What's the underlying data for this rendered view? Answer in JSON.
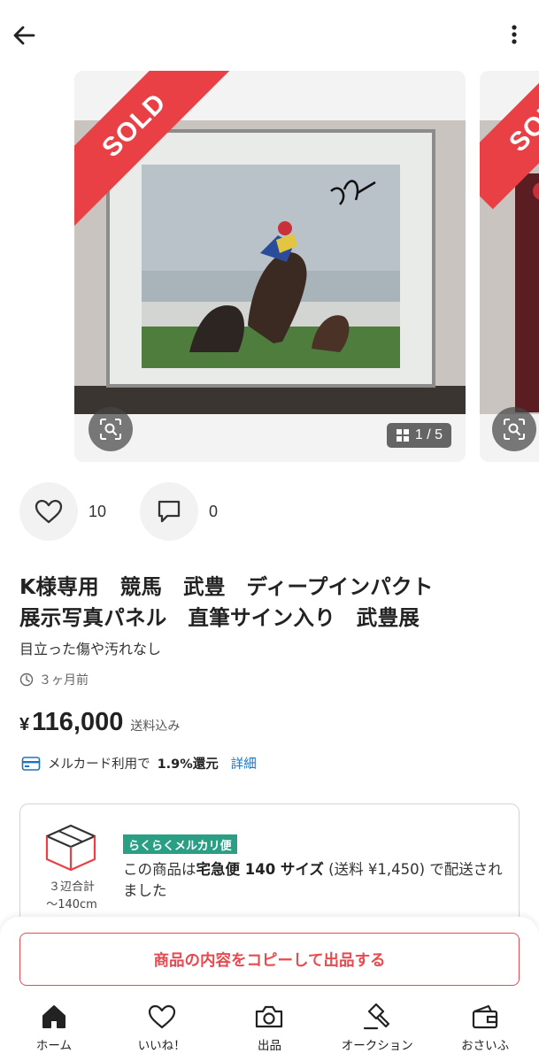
{
  "item": {
    "title": "K様専用　競馬　武豊　ディープインパクト\n展示写真パネル　直筆サイン入り　武豊展",
    "condition": "目立った傷や汚れなし",
    "posted": "３ヶ月前",
    "price_symbol": "¥",
    "price": "116,000",
    "shipping_included": "送料込み",
    "likes": "10",
    "comments": "0"
  },
  "gallery": {
    "sold_label": "SOLD",
    "counter": "1 / 5"
  },
  "card_promo": {
    "prefix": "メルカード利用で",
    "rate": "1.9%還元",
    "link": "詳細"
  },
  "shipping": {
    "size_label_1": "３辺合計",
    "size_label_2": "〜140cm",
    "badge": "らくらくメルカリ便",
    "text_1": "この商品は",
    "text_bold": "宅急便 140 サイズ",
    "text_2": " (送料 ¥1,450) で配送されました"
  },
  "cta": {
    "copy_listing": "商品の内容をコピーして出品する"
  },
  "tabs": [
    {
      "label": "ホーム",
      "icon": "home-icon"
    },
    {
      "label": "いいね！",
      "icon": "heart-icon"
    },
    {
      "label": "出品",
      "icon": "camera-icon"
    },
    {
      "label": "オークション",
      "icon": "gavel-icon"
    },
    {
      "label": "おさいふ",
      "icon": "wallet-icon"
    }
  ],
  "colors": {
    "sold_ribbon": "#e94045",
    "accent_red": "#e94a4f",
    "badge_green": "#2b9f83",
    "link_blue": "#1f73c4"
  }
}
